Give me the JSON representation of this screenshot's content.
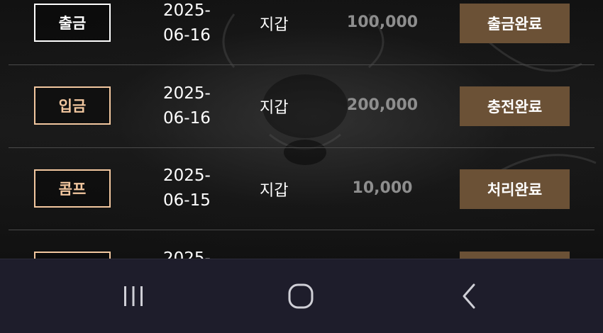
{
  "transactions": [
    {
      "type": "출금",
      "type_style": "white",
      "date_line1": "2025-",
      "date_line2": "06-16",
      "wallet": "지갑",
      "amount": "100,000",
      "status": "출금완료"
    },
    {
      "type": "입금",
      "type_style": "peach",
      "date_line1": "2025-",
      "date_line2": "06-16",
      "wallet": "지갑",
      "amount": "200,000",
      "status": "충전완료"
    },
    {
      "type": "콤프",
      "type_style": "peach",
      "date_line1": "2025-",
      "date_line2": "06-15",
      "wallet": "지갑",
      "amount": "10,000",
      "status": "처리완료"
    },
    {
      "type": "",
      "type_style": "peach",
      "date_line1": "2025-",
      "date_line2": "",
      "wallet": "",
      "amount": "",
      "status": ""
    }
  ],
  "nav": {
    "icons": [
      "recent-apps-icon",
      "home-icon",
      "back-icon"
    ]
  },
  "colors": {
    "status_bg": "#6b5136",
    "peach": "#f2c79f",
    "navbar": "#1e1d2b",
    "amount": "#8e8e8e"
  }
}
